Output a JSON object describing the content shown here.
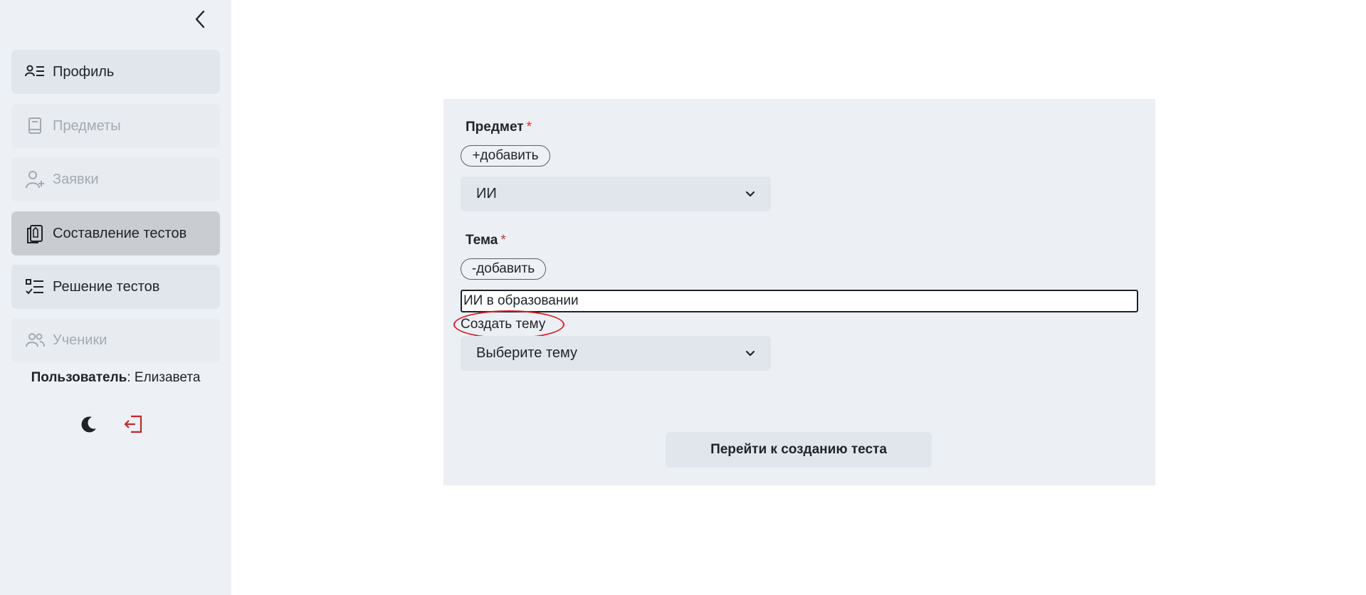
{
  "sidebar": {
    "items": [
      {
        "label": "Профиль",
        "icon": "profile-list-icon",
        "state": "normal"
      },
      {
        "label": "Предметы",
        "icon": "book-icon",
        "state": "disabled"
      },
      {
        "label": "Заявки",
        "icon": "user-add-icon",
        "state": "disabled"
      },
      {
        "label": "Составление тестов",
        "icon": "copy-pencil-icon",
        "state": "active"
      },
      {
        "label": "Решение тестов",
        "icon": "checklist-icon",
        "state": "normal"
      },
      {
        "label": "Ученики",
        "icon": "users-icon",
        "state": "disabled"
      }
    ],
    "user_label": "Пользователь",
    "user_sep": ": ",
    "user_name": "Елизавета"
  },
  "form": {
    "subject_label": "Предмет",
    "required_mark": "*",
    "subject_add": "+добавить",
    "subject_value": "ИИ",
    "topic_label": "Тема",
    "topic_add": "-добавить",
    "topic_input_value": "ИИ в образовании",
    "create_topic": "Создать тему",
    "topic_select_placeholder": "Выберите тему",
    "submit": "Перейти к созданию теста"
  },
  "colors": {
    "required": "#d03030",
    "logout": "#c0272d",
    "annotation": "#d42027"
  }
}
